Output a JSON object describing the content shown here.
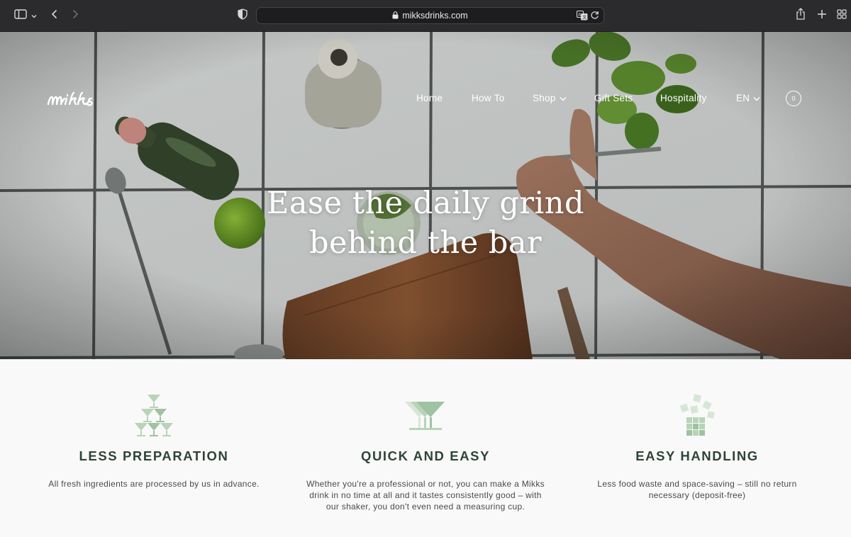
{
  "browser": {
    "url": "mikksdrinks.com",
    "icons": [
      "sidebar-icon",
      "chevron-down-icon",
      "back-icon",
      "forward-icon",
      "shield-icon",
      "lock-icon",
      "translate-icon",
      "reload-icon",
      "share-icon",
      "plus-icon",
      "tab-grid-icon"
    ]
  },
  "site": {
    "logo_text": "mikks",
    "nav": [
      {
        "label": "Home"
      },
      {
        "label": "How To"
      },
      {
        "label": "Shop"
      },
      {
        "label": "Gift Sets"
      },
      {
        "label": "Hospitality"
      },
      {
        "label": "EN"
      }
    ],
    "cart_count": "0"
  },
  "hero": {
    "title_line1": "Ease the daily grind",
    "title_line2": "behind the bar"
  },
  "features": [
    {
      "icon": "glass-pyramid-icon",
      "title": "LESS PREPARATION",
      "text": "All fresh ingredients are processed by us in advance."
    },
    {
      "icon": "cocktail-glasses-icon",
      "title": "QUICK AND EASY",
      "text": "Whether you're a professional or not, you can make a Mikks drink in no time at all and it tastes consistently good – with our shaker, you don't even need a measuring cup."
    },
    {
      "icon": "ice-cubes-icon",
      "title": "EASY HANDLING",
      "text": "Less food waste and space-saving – still no return necessary (deposit-free)"
    }
  ],
  "colors": {
    "heading": "#2e4437",
    "icon_green": "#b8d3b9",
    "chrome": "#2b2b2d"
  }
}
